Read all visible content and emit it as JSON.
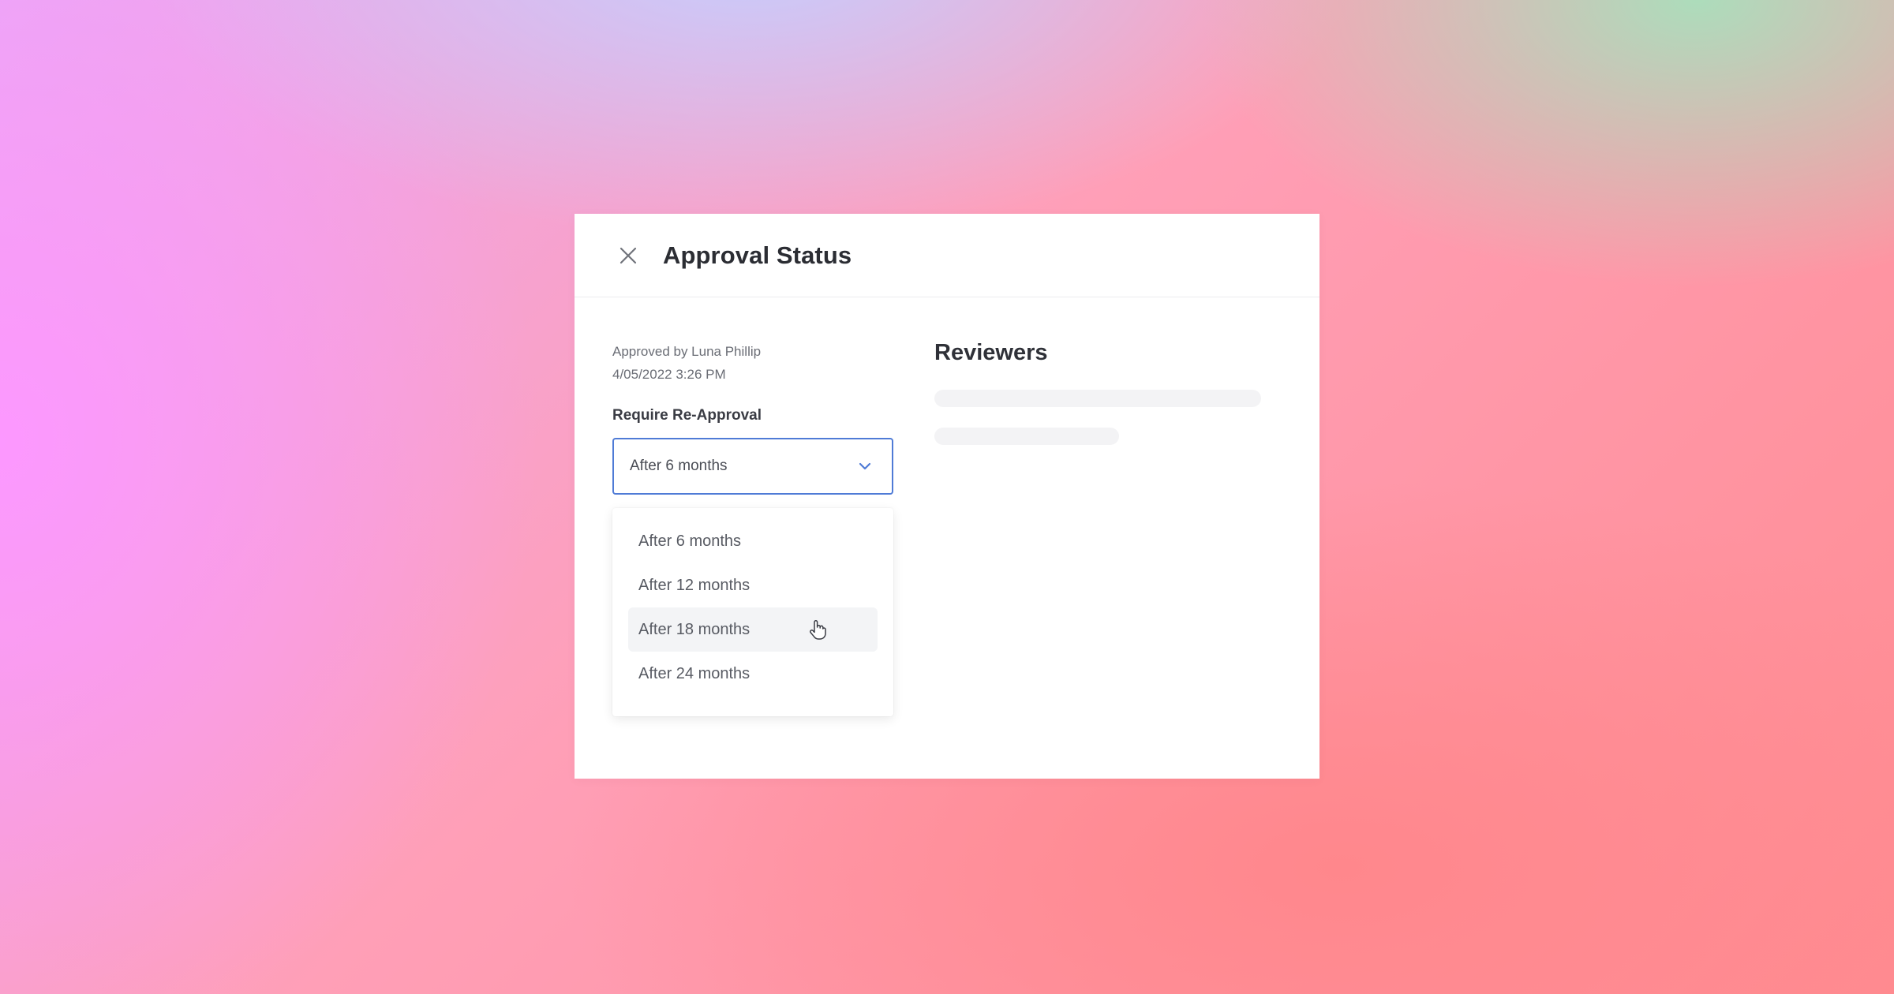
{
  "modal": {
    "title": "Approval Status",
    "close_icon": "close-icon"
  },
  "approval": {
    "approved_by": "Approved by Luna Phillip",
    "timestamp": "4/05/2022 3:26 PM",
    "reapproval_label": "Require Re-Approval",
    "selected_value": "After 6 months",
    "options": [
      {
        "label": "After 6 months",
        "highlighted": false
      },
      {
        "label": "After 12 months",
        "highlighted": false
      },
      {
        "label": "After 18 months",
        "highlighted": true
      },
      {
        "label": "After 24 months",
        "highlighted": false
      }
    ]
  },
  "reviewers": {
    "title": "Reviewers",
    "loading": true
  },
  "colors": {
    "accent": "#4f7bd6",
    "title_text": "#2b2d33",
    "highlight_bg": "#f3f4f6",
    "skeleton": "#f3f3f5"
  }
}
